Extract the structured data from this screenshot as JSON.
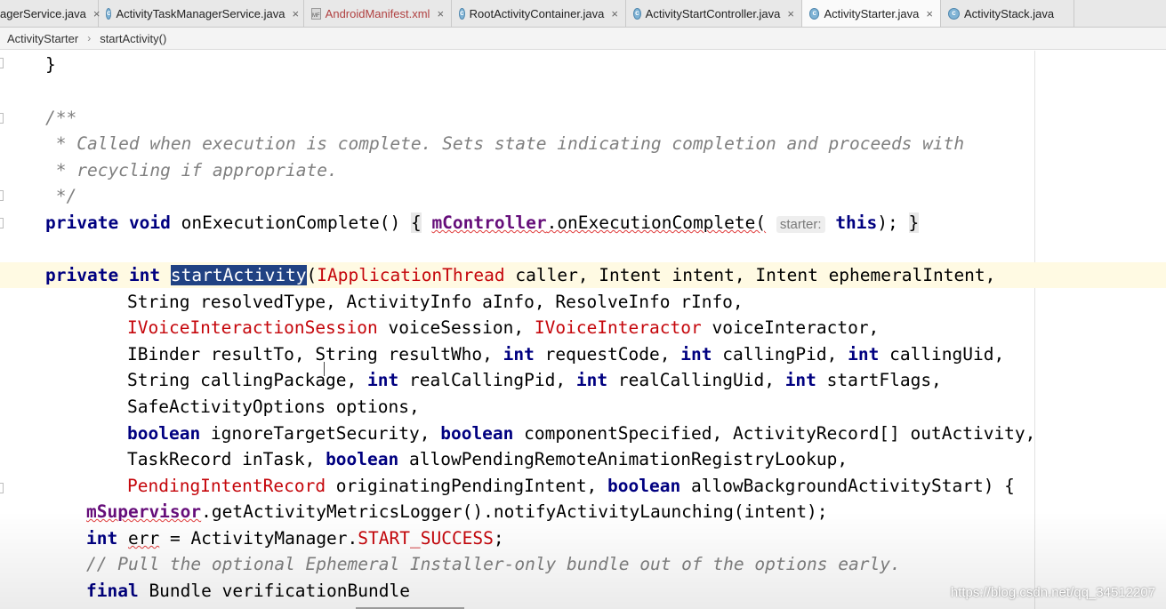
{
  "tabs": [
    {
      "label": "agerService.java",
      "icon": "class-icon",
      "active": false
    },
    {
      "label": "ActivityTaskManagerService.java",
      "icon": "class-icon",
      "active": false
    },
    {
      "label": "AndroidManifest.xml",
      "icon": "manifest-icon",
      "active": false
    },
    {
      "label": "RootActivityContainer.java",
      "icon": "class-icon",
      "active": false
    },
    {
      "label": "ActivityStartController.java",
      "icon": "class-icon",
      "active": false
    },
    {
      "label": "ActivityStarter.java",
      "icon": "class-icon",
      "active": true,
      "close": "×"
    },
    {
      "label": "ActivityStack.java",
      "icon": "class-icon",
      "active": false
    }
  ],
  "breadcrumb": {
    "class": "ActivityStarter",
    "separator": "›",
    "method": "startActivity()"
  },
  "code": {
    "l1": "}",
    "l2": "/**",
    "l3": " * Called when execution is complete. Sets state indicating completion and proceeds with",
    "l4": " * recycling if appropriate.",
    "l5": " */",
    "l6": {
      "kw1": "private",
      "kw2": "void",
      "sig": " onExecutionComplete() ",
      "lbrace": "{",
      "sp": " ",
      "field": "mController",
      "call": ".onExecutionComplete(",
      "hint": "starter:",
      "this": "this",
      "tail": "); ",
      "rbrace": "}"
    },
    "l7": {
      "kw1": "private",
      "kw2": "int",
      "name": "startActivity",
      "paren": "(",
      "t1": "IApplicationThread",
      "rest": " caller, Intent intent, Intent ephemeralIntent,"
    },
    "l8": "String resolvedType, ActivityInfo aInfo, ResolveInfo rInfo,",
    "l9": {
      "t1": "IVoiceInteractionSession",
      "a": " voiceSession, ",
      "t2": "IVoiceInteractor",
      "b": " voiceInteractor,"
    },
    "l10": {
      "a": "IBinder resultTo, String resultWho, ",
      "kw": "int",
      "b": " requestCode, ",
      "c": " callingPid, ",
      "d": " callingUid,"
    },
    "l11": {
      "a": "String callingPackage, ",
      "kw": "int",
      "b": " realCallingPid, ",
      "c": " realCallingUid, ",
      "d": " startFlags,"
    },
    "l12": "SafeActivityOptions options,",
    "l13": {
      "kw": "boolean",
      "a": " ignoreTargetSecurity, ",
      "b": " componentSpecified, ActivityRecord[] outActivity,"
    },
    "l14": {
      "a": "TaskRecord inTask, ",
      "kw": "boolean",
      "b": " allowPendingRemoteAnimationRegistryLookup,"
    },
    "l15": {
      "t1": "PendingIntentRecord",
      "a": " originatingPendingIntent, ",
      "kw": "boolean",
      "b": " allowBackgroundActivityStart) {"
    },
    "l16": {
      "field": "mSupervisor",
      "rest": ".getActivityMetricsLogger().notifyActivityLaunching(intent);"
    },
    "l17": {
      "kw": "int",
      "var": "err",
      "mid": " = ActivityManager.",
      "const": "START_SUCCESS",
      "end": ";"
    },
    "l18": "// Pull the optional Ephemeral Installer-only bundle out of the options early.",
    "l19": {
      "kw": "final",
      "rest": " Bundle verificationBundle"
    }
  },
  "watermark": "https://blog.csdn.net/qq_34512207",
  "colors": {
    "keyword": "#000080",
    "type_red": "#c5060b",
    "comment": "#808080",
    "field": "#660e7a",
    "selection": "#214283",
    "line_highlight": "#fffae3"
  }
}
